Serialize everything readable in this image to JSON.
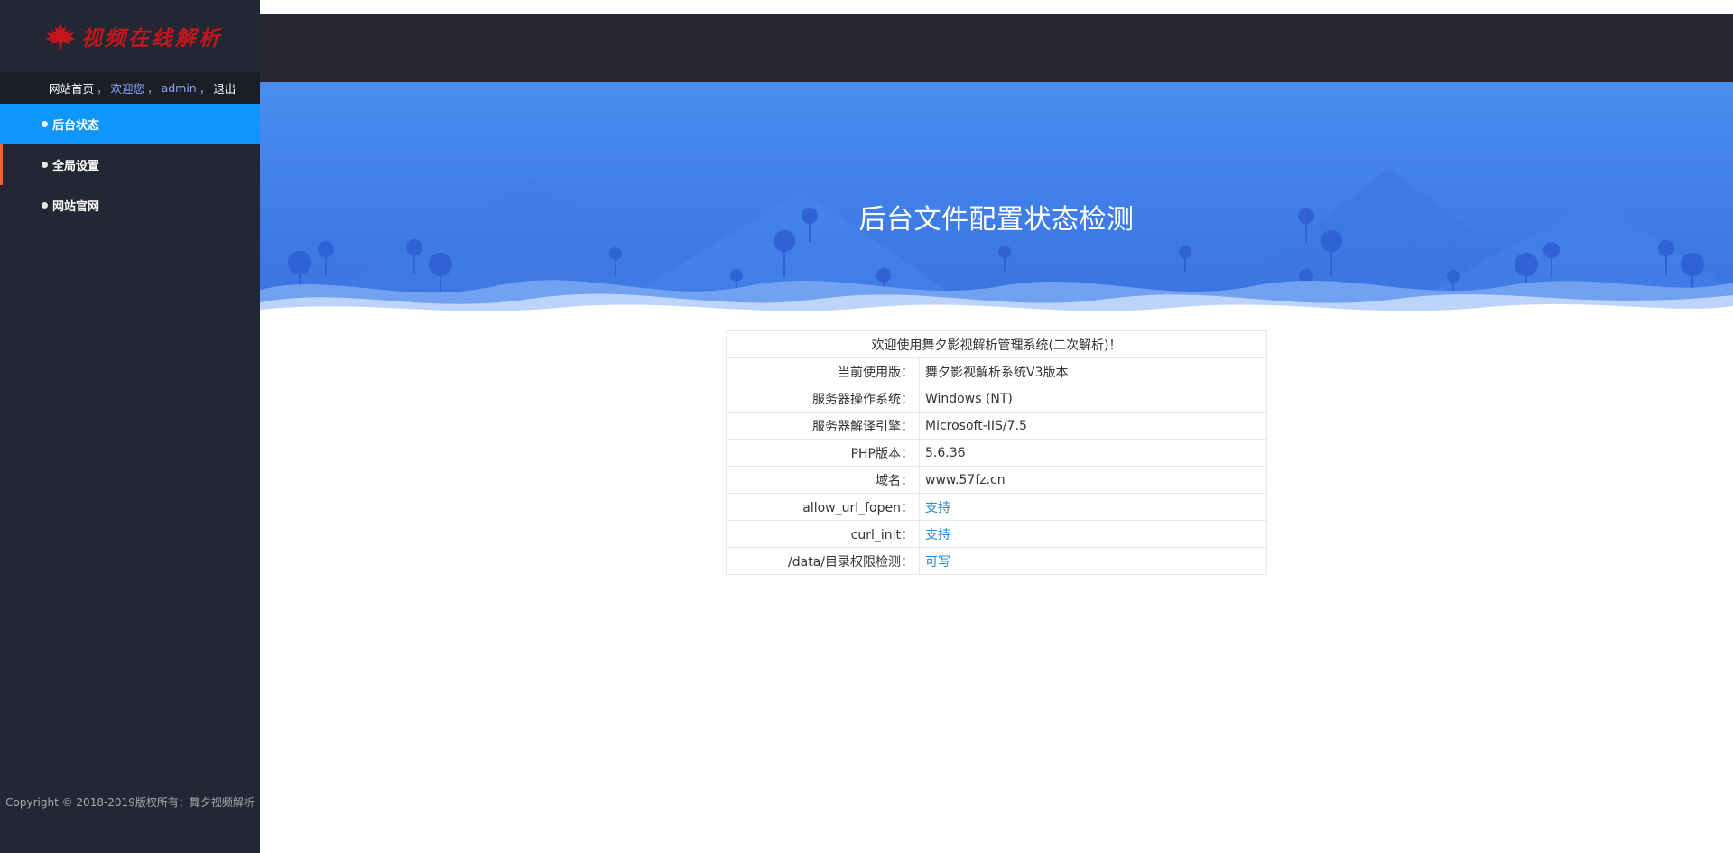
{
  "sidebar": {
    "logo_text": "视频在线解析",
    "userbar": {
      "home_link": "网站首页",
      "sep1": "，",
      "welcome": "欢迎您",
      "sep2": "，",
      "username": "admin",
      "sep3": "，",
      "logout": "退出"
    },
    "menu": [
      {
        "label": "后台状态"
      },
      {
        "label": "全局设置"
      },
      {
        "label": "网站官网"
      }
    ],
    "copyright": "Copyright © 2018-2019版权所有：舞夕视频解析"
  },
  "banner": {
    "title": "后台文件配置状态检测"
  },
  "info": {
    "heading": "欢迎使用舞夕影视解析管理系统(二次解析)！",
    "rows": [
      {
        "key": "当前使用版：",
        "value": "舞夕影视解析系统V3版本"
      },
      {
        "key": "服务器操作系统：",
        "value": "Windows (NT)"
      },
      {
        "key": "服务器解译引擎：",
        "value": "Microsoft-IIS/7.5"
      },
      {
        "key": "PHP版本：",
        "value": "5.6.36"
      },
      {
        "key": "域名：",
        "value": "www.57fz.cn"
      },
      {
        "key": "allow_url_fopen：",
        "value": "支持"
      },
      {
        "key": "curl_init：",
        "value": "支持"
      },
      {
        "key": "/data/目录权限检测：",
        "value": "可写"
      }
    ]
  },
  "colors": {
    "sidebar_bg": "#232633",
    "menu_active": "#0f96fb",
    "menu_marker": "#ff5a36",
    "status_ok": "#1e88e5",
    "banner_blue": "#4180ea"
  },
  "icons": {
    "logo": "maple-leaf-icon",
    "menu_bullet": "dot-icon"
  }
}
